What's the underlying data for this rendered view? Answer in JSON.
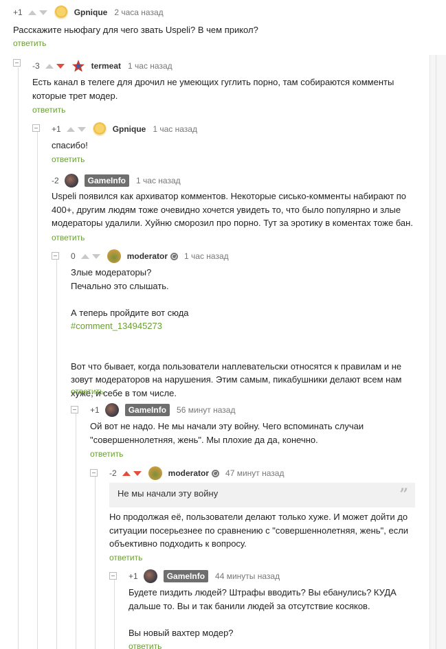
{
  "reply_label": "ответить",
  "comments": [
    {
      "score": "+1",
      "user": "Gpnique",
      "time": "2 часа назад",
      "text": [
        "Расскажите ньюфагу для чего звать Uspeli? В чем прикол?"
      ]
    },
    {
      "score": "-3",
      "user": "termeat",
      "time": "1 час назад",
      "text": [
        "Есть канал в телеге для дрочил не умеющих гуглить порно, там собираются комменты",
        "которые трет модер."
      ]
    },
    {
      "score": "+1",
      "user": "Gpnique",
      "time": "1 час назад",
      "text": [
        "спасибо!"
      ]
    },
    {
      "score": "-2",
      "user": "GameInfo",
      "time": "1 час назад",
      "text": [
        "Uspeli появился как архиватор комментов. Некоторые сисько-комменты набирают по",
        "400+, другим людям тоже очевидно хочется увидеть то, что было популярно и злые",
        "модераторы удалили. Хуйню сморозил про порно. Тут за эротику в коментах тоже бан."
      ]
    },
    {
      "score": "0",
      "user": "moderator",
      "time": "1 час назад",
      "text": [
        "Злые модераторы?",
        "Печально это слышать."
      ],
      "text2": "А теперь пройдите вот сюда",
      "link": "#comment_134945273",
      "text3": [
        "Вот что бывает, когда пользователи наплевательски относятся к правилам и не",
        "зовут модераторов на нарушения. Этим самым, пикабушники делают всем нам",
        "хуже, и себе в том числе."
      ]
    },
    {
      "score": "+1",
      "user": "GameInfo",
      "time": "56 минут назад",
      "text": [
        "Ой вот не надо. Не мы начали эту войну. Чего вспоминать случаи",
        "\"совершеннолетняя, жень\". Мы плохие да да, конечно."
      ]
    },
    {
      "score": "-2",
      "user": "moderator",
      "time": "47 минут назад",
      "quote": "Не мы начали эту войну",
      "text": [
        "Но продолжая её, пользователи делают только хуже. И может дойти до",
        "ситуации посерьезнее по сравнению с \"совершеннолетняя, жень\", если",
        "объективно подходить к вопросу."
      ]
    },
    {
      "score": "+1",
      "user": "GameInfo",
      "time": "44 минуты назад",
      "text": [
        "Будете пиздить людей? Штрафы вводить? Вы ебанулись? КУДА",
        "дальше то. Вы и так банили людей за отсутствие косяков."
      ],
      "text2": "Вы новый вахтер модер?"
    }
  ]
}
